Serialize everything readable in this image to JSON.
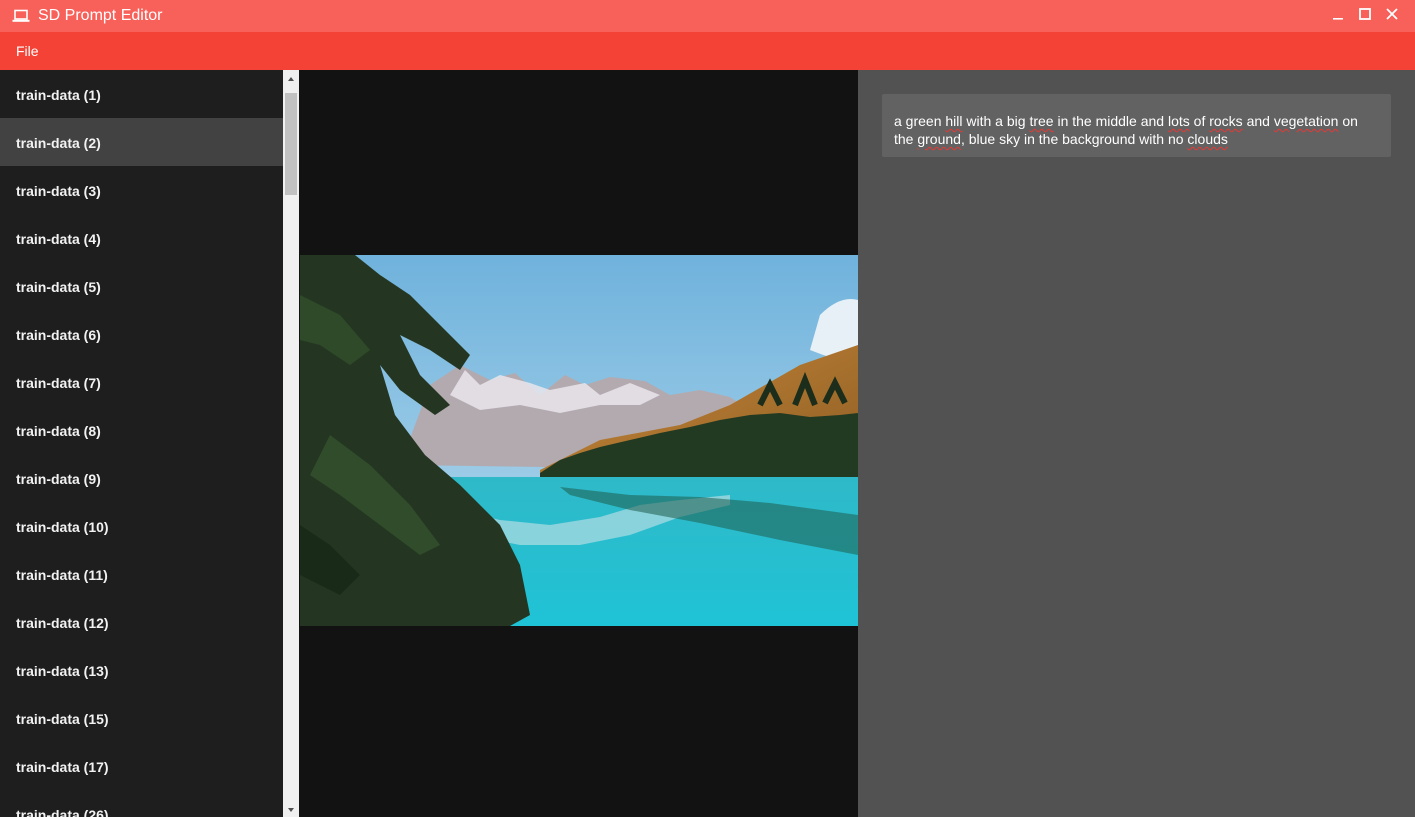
{
  "window": {
    "title": "SD Prompt Editor",
    "icon": "laptop-icon",
    "controls": [
      "minimize-icon",
      "maximize-icon",
      "close-icon"
    ]
  },
  "menu": {
    "items": [
      {
        "label": "File"
      }
    ]
  },
  "file_list": {
    "selected_index": 1,
    "items": [
      {
        "label": "train-data (1)"
      },
      {
        "label": "train-data (2)"
      },
      {
        "label": "train-data (3)"
      },
      {
        "label": "train-data (4)"
      },
      {
        "label": "train-data (5)"
      },
      {
        "label": "train-data (6)"
      },
      {
        "label": "train-data (7)"
      },
      {
        "label": "train-data (8)"
      },
      {
        "label": "train-data (9)"
      },
      {
        "label": "train-data (10)"
      },
      {
        "label": "train-data (11)"
      },
      {
        "label": "train-data (12)"
      },
      {
        "label": "train-data (13)"
      },
      {
        "label": "train-data (15)"
      },
      {
        "label": "train-data (17)"
      },
      {
        "label": "train-data (26)"
      }
    ]
  },
  "prompt": {
    "segments": [
      {
        "text": "a green ",
        "misspelled": false
      },
      {
        "text": "hill",
        "misspelled": true
      },
      {
        "text": " with a big ",
        "misspelled": false
      },
      {
        "text": "tree",
        "misspelled": true
      },
      {
        "text": " in the middle and ",
        "misspelled": false
      },
      {
        "text": "lots",
        "misspelled": true
      },
      {
        "text": " of ",
        "misspelled": false
      },
      {
        "text": "rocks",
        "misspelled": true
      },
      {
        "text": " and ",
        "misspelled": false
      },
      {
        "text": "vegetation",
        "misspelled": true
      },
      {
        "text": " on the ",
        "misspelled": false
      },
      {
        "text": "ground",
        "misspelled": true
      },
      {
        "text": ", blue sky in the background with no ",
        "misspelled": false
      },
      {
        "text": "clouds",
        "misspelled": true
      }
    ]
  },
  "colors": {
    "titlebar": "#f8605a",
    "menubar": "#f44336",
    "sidebar": "#1e1e1e",
    "sidebar_selected": "#424242",
    "viewer": "#121212",
    "prompt_panel": "#525252",
    "prompt_box": "#626262",
    "spellcheck_underline": "#e53935"
  }
}
